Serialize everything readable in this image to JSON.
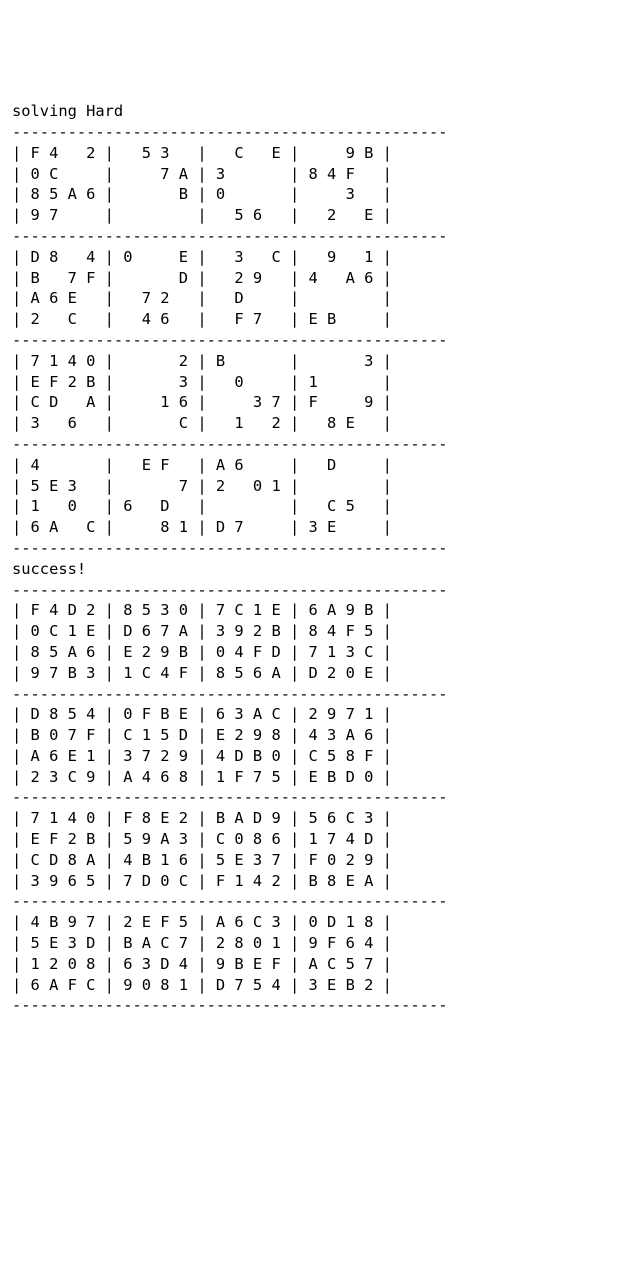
{
  "headings": {
    "h1": "solving Hard",
    "h2": "success!"
  },
  "divider": "-----------------------------------------------",
  "puzzle": [
    [
      [
        "F",
        "4",
        " ",
        "2"
      ],
      [
        " ",
        "5",
        "3",
        " "
      ],
      [
        " ",
        "C",
        " ",
        "E"
      ],
      [
        " ",
        " ",
        "9",
        "B"
      ]
    ],
    [
      [
        "0",
        "C",
        " ",
        " "
      ],
      [
        " ",
        " ",
        "7",
        "A"
      ],
      [
        "3",
        " ",
        " ",
        " "
      ],
      [
        "8",
        "4",
        "F",
        " "
      ]
    ],
    [
      [
        "8",
        "5",
        "A",
        "6"
      ],
      [
        " ",
        " ",
        " ",
        "B"
      ],
      [
        "0",
        " ",
        " ",
        " "
      ],
      [
        " ",
        " ",
        "3",
        " "
      ]
    ],
    [
      [
        "9",
        "7",
        " ",
        " "
      ],
      [
        " ",
        " ",
        " ",
        " "
      ],
      [
        " ",
        "5",
        "6",
        " "
      ],
      [
        " ",
        "2",
        " ",
        "E"
      ]
    ],
    [
      [
        "D",
        "8",
        " ",
        "4"
      ],
      [
        "0",
        " ",
        " ",
        "E"
      ],
      [
        " ",
        "3",
        " ",
        "C"
      ],
      [
        " ",
        "9",
        " ",
        "1"
      ]
    ],
    [
      [
        "B",
        " ",
        "7",
        "F"
      ],
      [
        " ",
        " ",
        " ",
        "D"
      ],
      [
        " ",
        "2",
        "9",
        " "
      ],
      [
        "4",
        " ",
        "A",
        "6"
      ]
    ],
    [
      [
        "A",
        "6",
        "E",
        " "
      ],
      [
        " ",
        "7",
        "2",
        " "
      ],
      [
        " ",
        "D",
        " ",
        " "
      ],
      [
        " ",
        " ",
        " ",
        " "
      ]
    ],
    [
      [
        "2",
        " ",
        "C",
        " "
      ],
      [
        " ",
        "4",
        "6",
        " "
      ],
      [
        " ",
        "F",
        "7",
        " "
      ],
      [
        "E",
        "B",
        " ",
        " "
      ]
    ],
    [
      [
        "7",
        "1",
        "4",
        "0"
      ],
      [
        " ",
        " ",
        " ",
        "2"
      ],
      [
        "B",
        " ",
        " ",
        " "
      ],
      [
        " ",
        " ",
        " ",
        "3"
      ]
    ],
    [
      [
        "E",
        "F",
        "2",
        "B"
      ],
      [
        " ",
        " ",
        " ",
        "3"
      ],
      [
        " ",
        "0",
        " ",
        " "
      ],
      [
        "1",
        " ",
        " ",
        " "
      ]
    ],
    [
      [
        "C",
        "D",
        " ",
        "A"
      ],
      [
        " ",
        " ",
        "1",
        "6"
      ],
      [
        " ",
        " ",
        "3",
        "7"
      ],
      [
        "F",
        " ",
        " ",
        "9"
      ]
    ],
    [
      [
        "3",
        " ",
        "6",
        " "
      ],
      [
        " ",
        " ",
        " ",
        "C"
      ],
      [
        " ",
        "1",
        " ",
        "2"
      ],
      [
        " ",
        "8",
        "E",
        " "
      ]
    ],
    [
      [
        "4",
        " ",
        " ",
        " "
      ],
      [
        " ",
        "E",
        "F",
        " "
      ],
      [
        "A",
        "6",
        " ",
        " "
      ],
      [
        " ",
        "D",
        " ",
        " "
      ]
    ],
    [
      [
        "5",
        "E",
        "3",
        " "
      ],
      [
        " ",
        " ",
        " ",
        "7"
      ],
      [
        "2",
        " ",
        "0",
        "1"
      ],
      [
        " ",
        " ",
        " ",
        " "
      ]
    ],
    [
      [
        "1",
        " ",
        "0",
        " "
      ],
      [
        "6",
        " ",
        "D",
        " "
      ],
      [
        " ",
        " ",
        " ",
        " "
      ],
      [
        " ",
        "C",
        "5",
        " "
      ]
    ],
    [
      [
        "6",
        "A",
        " ",
        "C"
      ],
      [
        " ",
        " ",
        "8",
        "1"
      ],
      [
        "D",
        "7",
        " ",
        " "
      ],
      [
        "3",
        "E",
        " ",
        " "
      ]
    ]
  ],
  "solution": [
    [
      [
        "F",
        "4",
        "D",
        "2"
      ],
      [
        "8",
        "5",
        "3",
        "0"
      ],
      [
        "7",
        "C",
        "1",
        "E"
      ],
      [
        "6",
        "A",
        "9",
        "B"
      ]
    ],
    [
      [
        "0",
        "C",
        "1",
        "E"
      ],
      [
        "D",
        "6",
        "7",
        "A"
      ],
      [
        "3",
        "9",
        "2",
        "B"
      ],
      [
        "8",
        "4",
        "F",
        "5"
      ]
    ],
    [
      [
        "8",
        "5",
        "A",
        "6"
      ],
      [
        "E",
        "2",
        "9",
        "B"
      ],
      [
        "0",
        "4",
        "F",
        "D"
      ],
      [
        "7",
        "1",
        "3",
        "C"
      ]
    ],
    [
      [
        "9",
        "7",
        "B",
        "3"
      ],
      [
        "1",
        "C",
        "4",
        "F"
      ],
      [
        "8",
        "5",
        "6",
        "A"
      ],
      [
        "D",
        "2",
        "0",
        "E"
      ]
    ],
    [
      [
        "D",
        "8",
        "5",
        "4"
      ],
      [
        "0",
        "F",
        "B",
        "E"
      ],
      [
        "6",
        "3",
        "A",
        "C"
      ],
      [
        "2",
        "9",
        "7",
        "1"
      ]
    ],
    [
      [
        "B",
        "0",
        "7",
        "F"
      ],
      [
        "C",
        "1",
        "5",
        "D"
      ],
      [
        "E",
        "2",
        "9",
        "8"
      ],
      [
        "4",
        "3",
        "A",
        "6"
      ]
    ],
    [
      [
        "A",
        "6",
        "E",
        "1"
      ],
      [
        "3",
        "7",
        "2",
        "9"
      ],
      [
        "4",
        "D",
        "B",
        "0"
      ],
      [
        "C",
        "5",
        "8",
        "F"
      ]
    ],
    [
      [
        "2",
        "3",
        "C",
        "9"
      ],
      [
        "A",
        "4",
        "6",
        "8"
      ],
      [
        "1",
        "F",
        "7",
        "5"
      ],
      [
        "E",
        "B",
        "D",
        "0"
      ]
    ],
    [
      [
        "7",
        "1",
        "4",
        "0"
      ],
      [
        "F",
        "8",
        "E",
        "2"
      ],
      [
        "B",
        "A",
        "D",
        "9"
      ],
      [
        "5",
        "6",
        "C",
        "3"
      ]
    ],
    [
      [
        "E",
        "F",
        "2",
        "B"
      ],
      [
        "5",
        "9",
        "A",
        "3"
      ],
      [
        "C",
        "0",
        "8",
        "6"
      ],
      [
        "1",
        "7",
        "4",
        "D"
      ]
    ],
    [
      [
        "C",
        "D",
        "8",
        "A"
      ],
      [
        "4",
        "B",
        "1",
        "6"
      ],
      [
        "5",
        "E",
        "3",
        "7"
      ],
      [
        "F",
        "0",
        "2",
        "9"
      ]
    ],
    [
      [
        "3",
        "9",
        "6",
        "5"
      ],
      [
        "7",
        "D",
        "0",
        "C"
      ],
      [
        "F",
        "1",
        "4",
        "2"
      ],
      [
        "B",
        "8",
        "E",
        "A"
      ]
    ],
    [
      [
        "4",
        "B",
        "9",
        "7"
      ],
      [
        "2",
        "E",
        "F",
        "5"
      ],
      [
        "A",
        "6",
        "C",
        "3"
      ],
      [
        "0",
        "D",
        "1",
        "8"
      ]
    ],
    [
      [
        "5",
        "E",
        "3",
        "D"
      ],
      [
        "B",
        "A",
        "C",
        "7"
      ],
      [
        "2",
        "8",
        "0",
        "1"
      ],
      [
        "9",
        "F",
        "6",
        "4"
      ]
    ],
    [
      [
        "1",
        "2",
        "0",
        "8"
      ],
      [
        "6",
        "3",
        "D",
        "4"
      ],
      [
        "9",
        "B",
        "E",
        "F"
      ],
      [
        "A",
        "C",
        "5",
        "7"
      ]
    ],
    [
      [
        "6",
        "A",
        "F",
        "C"
      ],
      [
        "9",
        "0",
        "8",
        "1"
      ],
      [
        "D",
        "7",
        "5",
        "4"
      ],
      [
        "3",
        "E",
        "B",
        "2"
      ]
    ]
  ]
}
